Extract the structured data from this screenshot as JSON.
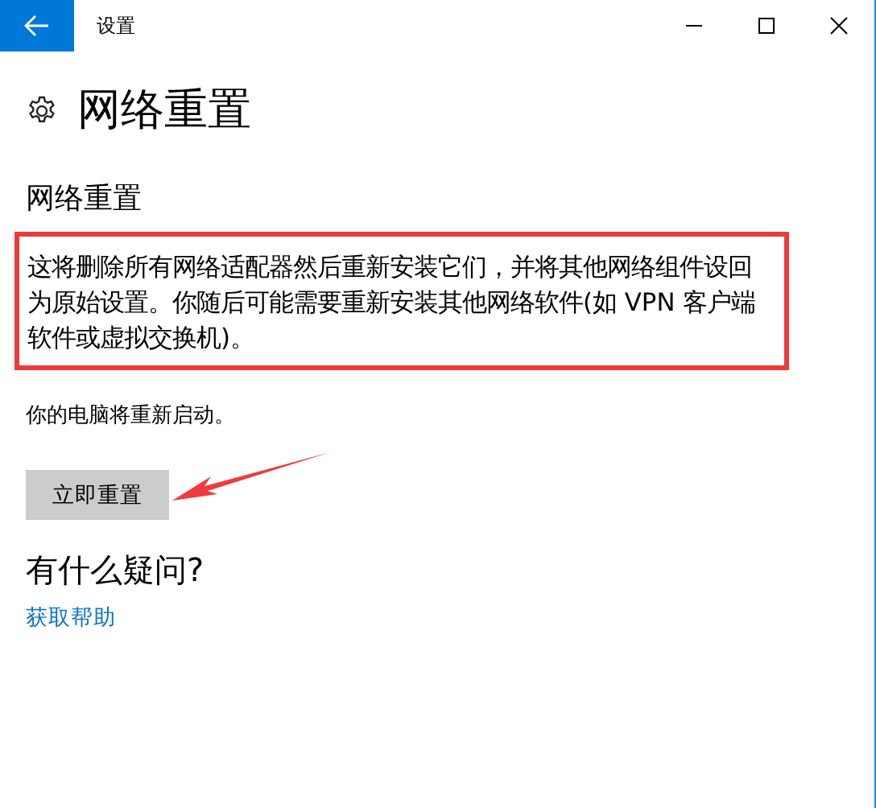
{
  "window": {
    "title": "设置"
  },
  "page": {
    "title": "网络重置"
  },
  "section": {
    "heading": "网络重置",
    "description": "这将删除所有网络适配器然后重新安装它们，并将其他网络组件设回为原始设置。你随后可能需要重新安装其他网络软件(如 VPN 客户端软件或虚拟交换机)。",
    "highlighted": true,
    "note": "你的电脑将重新启动。",
    "button": "立即重置",
    "arrow": true
  },
  "help": {
    "heading": "有什么疑问?",
    "link": "获取帮助"
  }
}
